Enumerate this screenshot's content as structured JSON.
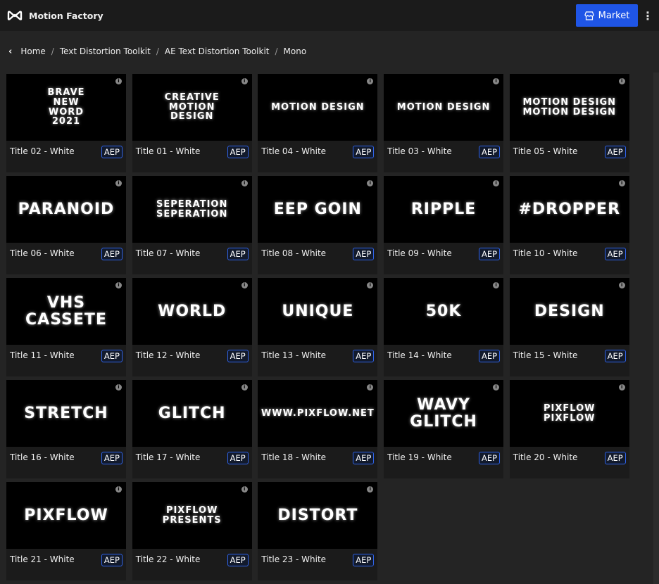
{
  "header": {
    "app_title": "Motion Factory",
    "market_label": "Market",
    "more_icon": "more-vertical-icon",
    "logo_icon": "motion-factory-logo",
    "accent": "#1f55e6"
  },
  "breadcrumb": [
    "Home",
    "Text Distortion Toolkit",
    "AE Text Distortion Toolkit",
    "Mono"
  ],
  "badge_color": "#2f63e8",
  "cards": [
    {
      "title": "Title 02 - White",
      "badge": "AEP",
      "thumb_text": "BRAVE\nNEW\nWORD\n2021"
    },
    {
      "title": "Title 01 - White",
      "badge": "AEP",
      "thumb_text": "CREATIVE\nMOTION\nDESIGN"
    },
    {
      "title": "Title 04 - White",
      "badge": "AEP",
      "thumb_text": "MOTION DESIGN"
    },
    {
      "title": "Title 03 - White",
      "badge": "AEP",
      "thumb_text": "MOTION DESIGN"
    },
    {
      "title": "Title 05 - White",
      "badge": "AEP",
      "thumb_text": "MOTION DESIGN MOTION DESIGN"
    },
    {
      "title": "Title 06 - White",
      "badge": "AEP",
      "thumb_text": "PARANOID"
    },
    {
      "title": "Title 07 - White",
      "badge": "AEP",
      "thumb_text": "SEPERATION\nSEPERATION"
    },
    {
      "title": "Title 08 - White",
      "badge": "AEP",
      "thumb_text": "EEP GOIN"
    },
    {
      "title": "Title 09 - White",
      "badge": "AEP",
      "thumb_text": "RIPPLE"
    },
    {
      "title": "Title 10 - White",
      "badge": "AEP",
      "thumb_text": "#DROPPER"
    },
    {
      "title": "Title 11 - White",
      "badge": "AEP",
      "thumb_text": "VHS CASSETE"
    },
    {
      "title": "Title 12 - White",
      "badge": "AEP",
      "thumb_text": "WORLD"
    },
    {
      "title": "Title 13 - White",
      "badge": "AEP",
      "thumb_text": "UNIQUE"
    },
    {
      "title": "Title 14 - White",
      "badge": "AEP",
      "thumb_text": "50K"
    },
    {
      "title": "Title 15 - White",
      "badge": "AEP",
      "thumb_text": "DESIGN"
    },
    {
      "title": "Title 16 - White",
      "badge": "AEP",
      "thumb_text": "STRETCH"
    },
    {
      "title": "Title 17 - White",
      "badge": "AEP",
      "thumb_text": "GLITCH"
    },
    {
      "title": "Title 18 - White",
      "badge": "AEP",
      "thumb_text": "WWW.PIXFLOW.NET"
    },
    {
      "title": "Title 19 - White",
      "badge": "AEP",
      "thumb_text": "WAVY GLITCH"
    },
    {
      "title": "Title 20 - White",
      "badge": "AEP",
      "thumb_text": "PIXFLOW\nPIXFLOW"
    },
    {
      "title": "Title 21 - White",
      "badge": "AEP",
      "thumb_text": "PIXFLOW"
    },
    {
      "title": "Title 22 - White",
      "badge": "AEP",
      "thumb_text": "PIXFLOW\nPRESENTS"
    },
    {
      "title": "Title 23 - White",
      "badge": "AEP",
      "thumb_text": "DISTORT"
    }
  ]
}
